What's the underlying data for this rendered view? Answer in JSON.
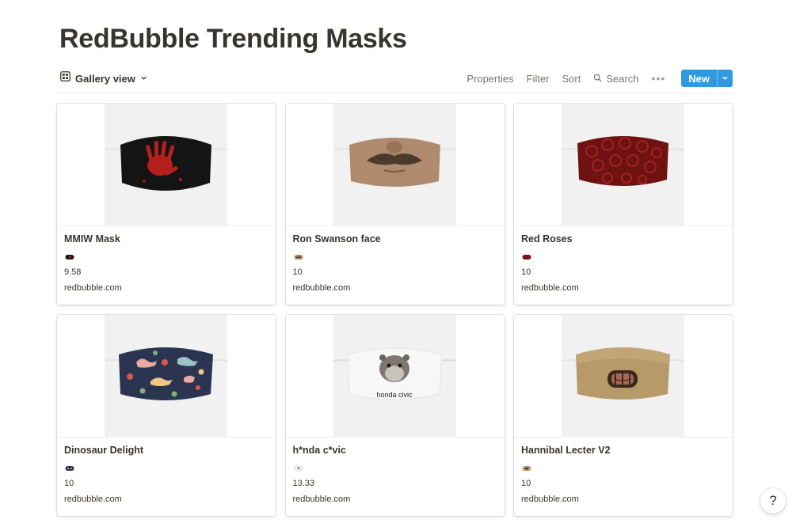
{
  "page": {
    "title": "RedBubble Trending Masks"
  },
  "toolbar": {
    "view_label": "Gallery view",
    "view_icon": "gallery-grid-icon",
    "properties": "Properties",
    "filter": "Filter",
    "sort": "Sort",
    "search": "Search",
    "more": "•••",
    "new": "New"
  },
  "colors": {
    "accent": "#2f9ae0",
    "text": "#37352f",
    "muted": "#787774"
  },
  "cards": [
    {
      "title": "MMIW Mask",
      "price": "9.58",
      "site": "redbubble.com",
      "mask_color": "#141414",
      "print": "red-handprint"
    },
    {
      "title": "Ron Swanson face",
      "price": "10",
      "site": "redbubble.com",
      "mask_color": "#b08a6c",
      "print": "mustache"
    },
    {
      "title": "Red Roses",
      "price": "10",
      "site": "redbubble.com",
      "mask_color": "#7a1414",
      "print": "roses"
    },
    {
      "title": "Dinosaur Delight",
      "price": "10",
      "site": "redbubble.com",
      "mask_color": "#2b3450",
      "print": "dinosaurs"
    },
    {
      "title": "h*nda c*vic",
      "price": "13.33",
      "site": "redbubble.com",
      "mask_color": "#f4f4f4",
      "print": "hamster",
      "mask_text": "honda civic"
    },
    {
      "title": "Hannibal Lecter V2",
      "price": "10",
      "site": "redbubble.com",
      "mask_color": "#b79a6a",
      "print": "lecter-grill"
    }
  ],
  "help": {
    "label": "?"
  }
}
